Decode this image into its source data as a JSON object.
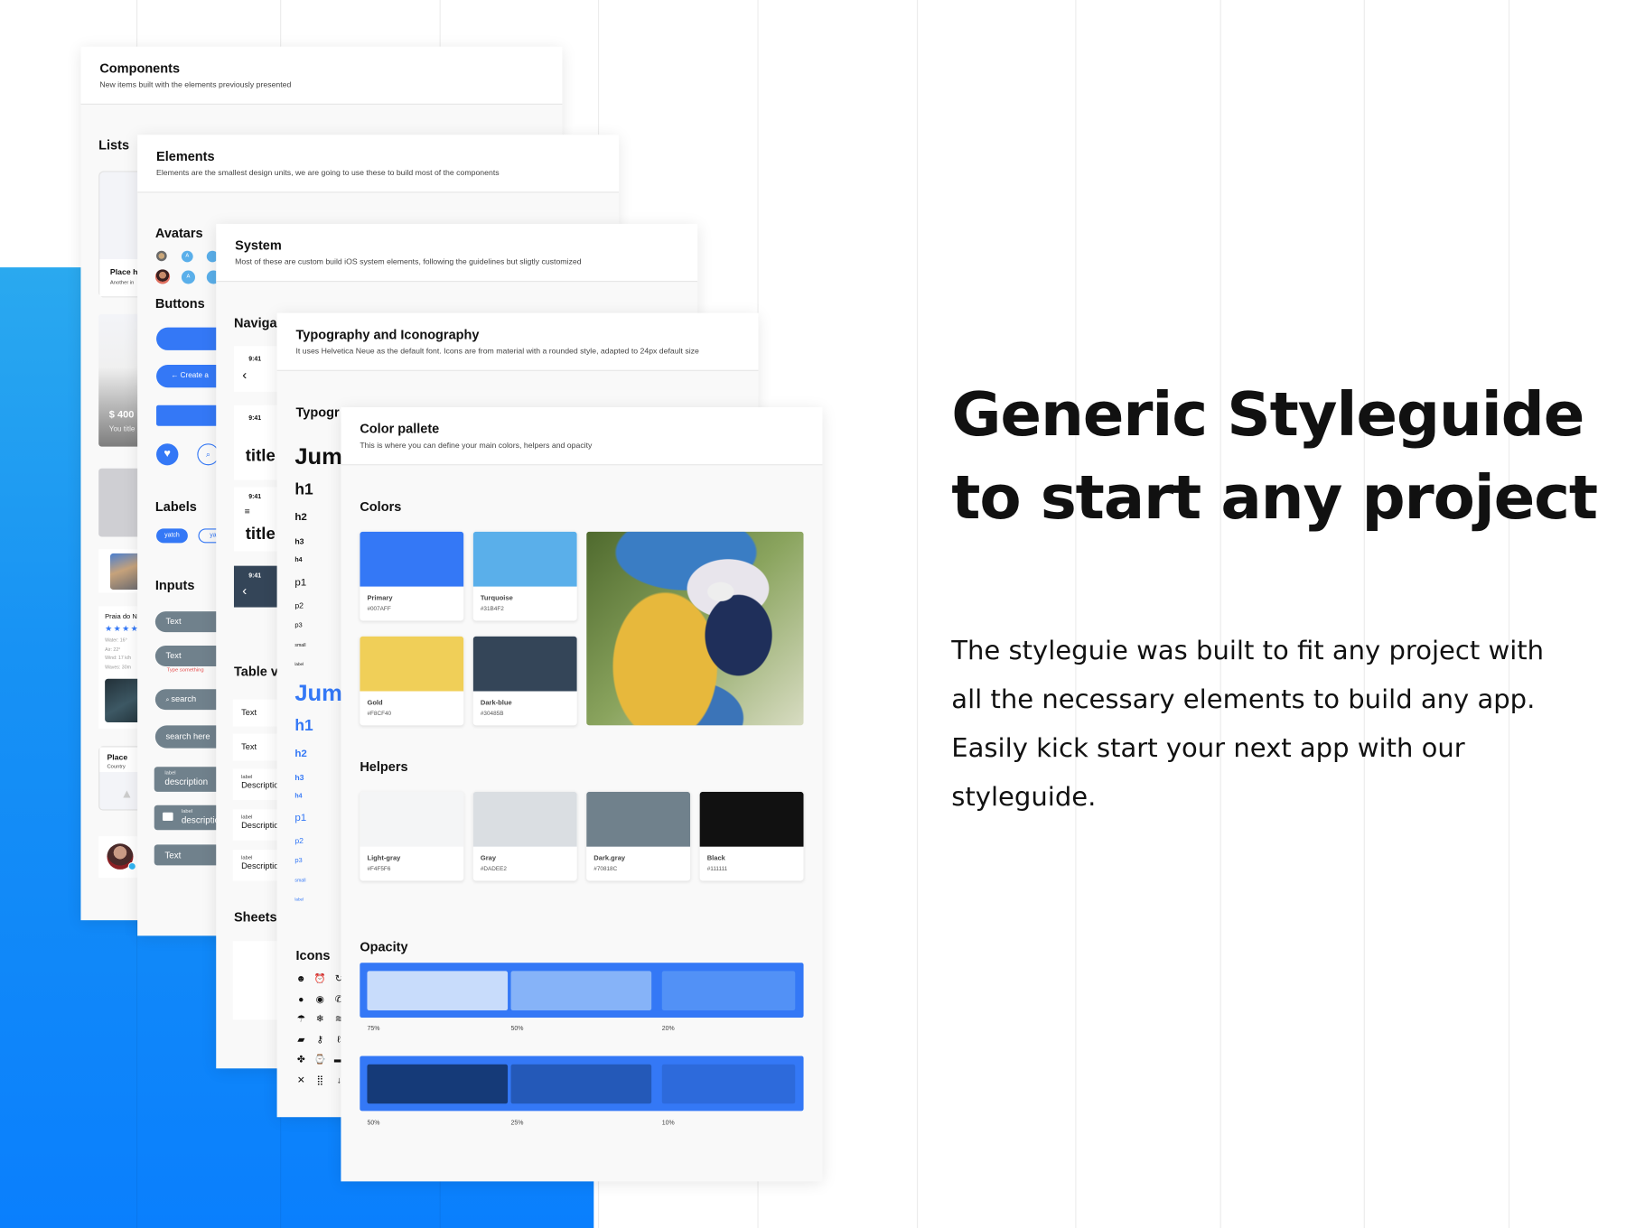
{
  "hero": {
    "title_line1": "Generic Styleguide",
    "title_line2": "to start any project",
    "body": "The styleguie was built to fit any project with all the necessary elements to build any app. Easily kick start your next app with our styleguide."
  },
  "components": {
    "title": "Components",
    "subtitle": "New items built with the elements previously presented",
    "lists_label": "Lists",
    "place_card_title": "Place h",
    "place_card_sub": "Another in",
    "price_title": "$ 400",
    "price_sub": "You title",
    "beach_title": "Praia do N",
    "beach_stats": [
      "Water: 16°",
      "Air: 22°",
      "Wind: 17 k/h",
      "Waves: 30m"
    ],
    "place_title": "Place",
    "place_sub": "Country"
  },
  "elements": {
    "title": "Elements",
    "subtitle": "Elements are the smallest design units, we are going to use these to build most of the components",
    "avatars_label": "Avatars",
    "avatar_letter": "A",
    "buttons_label": "Buttons",
    "create_button": "← Create a",
    "text_button": "Text",
    "labels_label": "Labels",
    "label_chip": "yatch",
    "label_chip_outline": "yat",
    "inputs_label": "Inputs",
    "input_text_1": "Text",
    "input_text_2": "Text",
    "input_error": "Type something",
    "search_input": "search",
    "search_here": "search here",
    "field_label": "label",
    "field_description": "description",
    "field_text": "Text"
  },
  "system": {
    "title": "System",
    "subtitle": "Most of these are custom build iOS system elements, following the guidelines but sligtly customized",
    "navigation_label": "Naviga",
    "time": "9:41",
    "nav_title": "title",
    "table_label": "Table v",
    "table_rows": [
      "Text",
      "Text"
    ],
    "table_label_small": "label",
    "table_desc": "Descriptio",
    "sheets_label": "Sheets"
  },
  "typography": {
    "title": "Typography and Iconography",
    "subtitle": "It uses Helvetica Neue as the default font. Icons are from material with a rounded style, adapted to 24px default size",
    "section_label": "Typogr",
    "samples": [
      "Jum",
      "h1",
      "h2",
      "h3",
      "h4",
      "p1",
      "p2",
      "p3",
      "small",
      "label"
    ],
    "icons_label": "Icons",
    "icons": [
      {
        "name": "account-circle-icon",
        "glyph": "☻"
      },
      {
        "name": "alarm-icon",
        "glyph": "⏰"
      },
      {
        "name": "refresh-icon",
        "glyph": "↻"
      },
      {
        "name": "alert-icon",
        "glyph": "●"
      },
      {
        "name": "play-circle-icon",
        "glyph": "◉"
      },
      {
        "name": "phone-icon",
        "glyph": "✆"
      },
      {
        "name": "beach-umbrella-icon",
        "glyph": "☂"
      },
      {
        "name": "snowflake-icon",
        "glyph": "❄"
      },
      {
        "name": "pool-icon",
        "glyph": "≋"
      },
      {
        "name": "chat-icon",
        "glyph": "▰"
      },
      {
        "name": "key-icon",
        "glyph": "⚷"
      },
      {
        "name": "temperature-icon",
        "glyph": "ℓ"
      },
      {
        "name": "fan-icon",
        "glyph": "✤"
      },
      {
        "name": "watch-icon",
        "glyph": "⌚"
      },
      {
        "name": "minus-icon",
        "glyph": "▬"
      },
      {
        "name": "restaurant-icon",
        "glyph": "✕"
      },
      {
        "name": "grid-icon",
        "glyph": "⣿"
      },
      {
        "name": "arrow-down-icon",
        "glyph": "↓"
      }
    ]
  },
  "palette": {
    "title": "Color pallete",
    "subtitle": "This is where you can define your main colors, helpers and opacity",
    "colors_label": "Colors",
    "colors": [
      {
        "name": "Primary",
        "hex": "#007AFF",
        "swatch": "#3478F6"
      },
      {
        "name": "Turquoise",
        "hex": "#31B4F2",
        "swatch": "#5AAFEA"
      },
      {
        "name": "Gold",
        "hex": "#F8CF40",
        "swatch": "#F0CF58"
      },
      {
        "name": "Dark-blue",
        "hex": "#30485B",
        "swatch": "#344558"
      }
    ],
    "helpers_label": "Helpers",
    "helpers": [
      {
        "name": "Light-gray",
        "hex": "#F4F5F6",
        "swatch": "#F4F5F6"
      },
      {
        "name": "Gray",
        "hex": "#DADEE2",
        "swatch": "#DADEE2"
      },
      {
        "name": "Dark.gray",
        "hex": "#70818C",
        "swatch": "#70818C"
      },
      {
        "name": "Black",
        "hex": "#111111",
        "swatch": "#111111"
      }
    ],
    "opacity_label": "Opacity",
    "opacity_light": [
      {
        "label": "75%",
        "color": "#C8DCFB"
      },
      {
        "label": "50%",
        "color": "#86B3F8"
      },
      {
        "label": "20%",
        "color": "#5291F6"
      }
    ],
    "opacity_dark": [
      {
        "label": "50%",
        "color": "#153A78"
      },
      {
        "label": "25%",
        "color": "#2459B8"
      },
      {
        "label": "10%",
        "color": "#2D6ADB"
      }
    ]
  }
}
